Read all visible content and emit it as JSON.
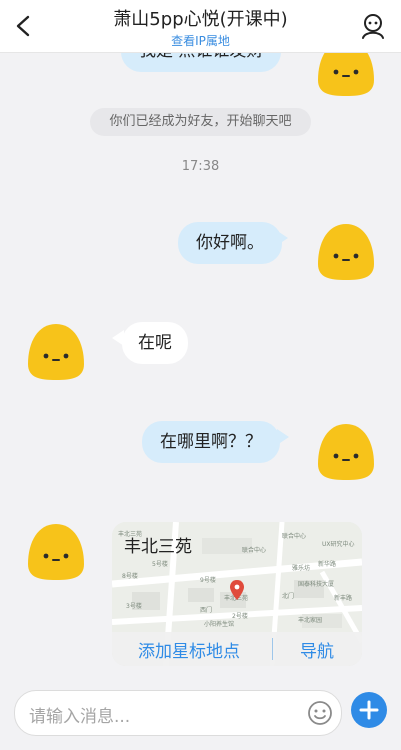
{
  "header": {
    "title": "萧山5pp心悦(开课中)",
    "subtitle": "查看IP属地"
  },
  "chat": {
    "partial_top_message": "我是 点谁谁发财",
    "system_message": "你们已经成为好友，开始聊天吧",
    "timestamp": "17:38",
    "messages": [
      {
        "direction": "out",
        "text": "你好啊。"
      },
      {
        "direction": "in",
        "text": "在呢"
      },
      {
        "direction": "out",
        "text": "在哪里啊？？"
      }
    ],
    "location_card": {
      "place_name": "丰北三苑",
      "favorite_label": "添加星标地点",
      "navigate_label": "导航",
      "map_labels": [
        "丰北三苑",
        "丰北三苑",
        "联合中心",
        "联合中心",
        "UX研究中心",
        "新华路",
        "国泰科技大厦",
        "西门",
        "北门",
        "雅乐坊",
        "小阳养生馆",
        "丰北家园",
        "新丰路",
        "8号楼",
        "9号楼",
        "5号楼",
        "3号楼",
        "2号楼"
      ]
    }
  },
  "input": {
    "placeholder": "请输入消息..."
  },
  "colors": {
    "accent": "#2f8be6",
    "outgoing_bubble": "#d6ecfb",
    "avatar_yellow": "#f7c31a"
  },
  "icons": {
    "back": "chevron-left-icon",
    "profile": "user-profile-icon",
    "emoji": "smiley-icon",
    "add": "plus-icon",
    "map_pin": "map-pin-icon"
  }
}
